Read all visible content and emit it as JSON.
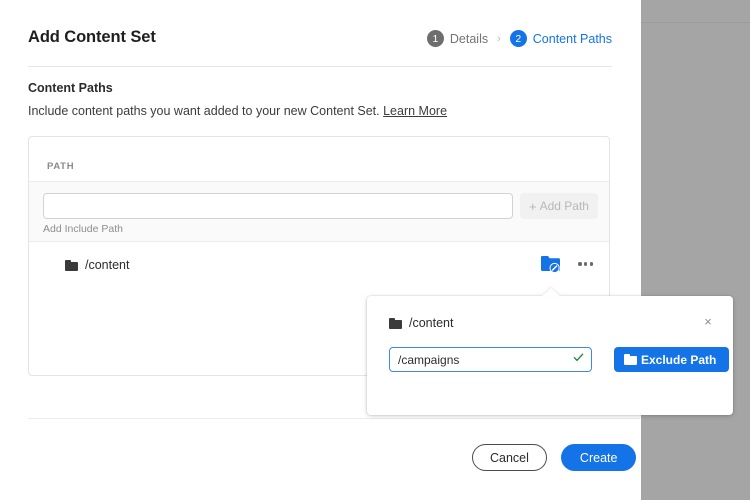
{
  "page": {
    "title": "Add Content Set"
  },
  "steps": [
    {
      "number": "1",
      "label": "Details",
      "state": "inactive"
    },
    {
      "number": "2",
      "label": "Content Paths",
      "state": "active"
    }
  ],
  "step_separator": "›",
  "section": {
    "title": "Content Paths",
    "description": "Include content paths you want added to your new Content Set.",
    "learn_more_label": "Learn More"
  },
  "paths_card": {
    "column_header": "PATH",
    "add_path": {
      "input_value": "",
      "input_placeholder": "",
      "button_label": "Add Path",
      "button_plus": "+",
      "hint": "Add Include Path"
    },
    "rows": [
      {
        "icon": "folder-icon",
        "path": "/content",
        "exclude_icon": "folder-exclude-icon",
        "more_icon": "more-actions-icon"
      }
    ]
  },
  "exclude_popover": {
    "folder_icon": "folder-icon",
    "path": "/content",
    "close_label": "×",
    "input_value": "/campaigns",
    "input_placeholder": "",
    "valid_icon": "check-icon",
    "button_label": "Exclude Path",
    "button_icon": "folder-icon"
  },
  "footer": {
    "cancel_label": "Cancel",
    "create_label": "Create"
  },
  "colors": {
    "accent_blue": "#1473e6",
    "step_inactive": "#6e6e6e",
    "valid_green": "#1a8a3c",
    "right_panel_gray": "#a5a5a5"
  }
}
